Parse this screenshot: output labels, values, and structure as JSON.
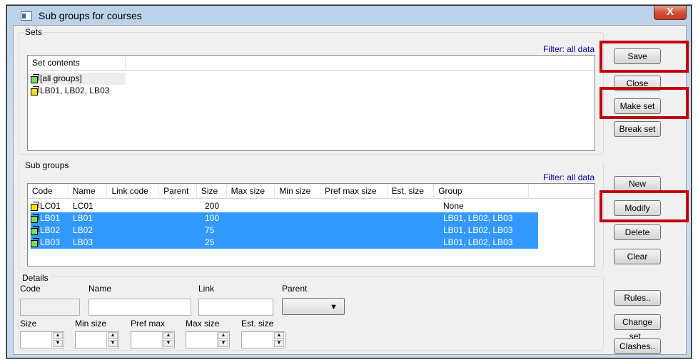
{
  "window": {
    "title": "Sub groups for courses",
    "close_glyph": "X"
  },
  "sets": {
    "label": "Sets",
    "filter": "Filter: all data",
    "header": "Set contents",
    "items": [
      {
        "icon": "cube-green-icon",
        "label": "[all groups]"
      },
      {
        "icon": "cube-yellow-icon",
        "label": "LB01, LB02, LB03"
      }
    ]
  },
  "subgroups": {
    "label": "Sub groups",
    "filter": "Filter: all data",
    "columns": [
      "Code",
      "Name",
      "Link code",
      "Parent",
      "Size",
      "Max size",
      "Min size",
      "Pref max size",
      "Est. size",
      "Group"
    ],
    "rows": [
      {
        "code": "LC01",
        "name": "LC01",
        "link": "",
        "parent": "",
        "size": "200",
        "max": "",
        "min": "",
        "prefmax": "",
        "est": "",
        "group": "None",
        "selected": false,
        "icon": "cube-yellow-icon"
      },
      {
        "code": "LB01",
        "name": "LB01",
        "link": "",
        "parent": "",
        "size": "100",
        "max": "",
        "min": "",
        "prefmax": "",
        "est": "",
        "group": "LB01, LB02, LB03",
        "selected": true,
        "icon": "cube-green-icon"
      },
      {
        "code": "LB02",
        "name": "LB02",
        "link": "",
        "parent": "",
        "size": "75",
        "max": "",
        "min": "",
        "prefmax": "",
        "est": "",
        "group": "LB01, LB02, LB03",
        "selected": true,
        "icon": "cube-green-icon"
      },
      {
        "code": "LB03",
        "name": "LB03",
        "link": "",
        "parent": "",
        "size": "25",
        "max": "",
        "min": "",
        "prefmax": "",
        "est": "",
        "group": "LB01, LB02, LB03",
        "selected": true,
        "icon": "cube-green-icon"
      }
    ]
  },
  "details": {
    "label": "Details",
    "code_label": "Code",
    "code_value": "",
    "name_label": "Name",
    "name_value": "",
    "link_label": "Link",
    "link_value": "",
    "parent_label": "Parent",
    "parent_value": "",
    "size_label": "Size",
    "size_value": "",
    "minsize_label": "Min size",
    "minsize_value": "",
    "prefmax_label": "Pref max",
    "prefmax_value": "",
    "maxsize_label": "Max size",
    "maxsize_value": "",
    "estsize_label": "Est. size",
    "estsize_value": ""
  },
  "buttons": {
    "save": "Save",
    "close": "Close",
    "make_set": "Make set",
    "break_set": "Break set",
    "new": "New",
    "modify": "Modify",
    "delete": "Delete",
    "clear": "Clear",
    "rules": "Rules..",
    "change_set": "Change set..",
    "clashes": "Clashes.."
  },
  "colors": {
    "highlight_box": "#c0000b",
    "selection": "#3399ff",
    "filter_text": "#0000a0"
  }
}
